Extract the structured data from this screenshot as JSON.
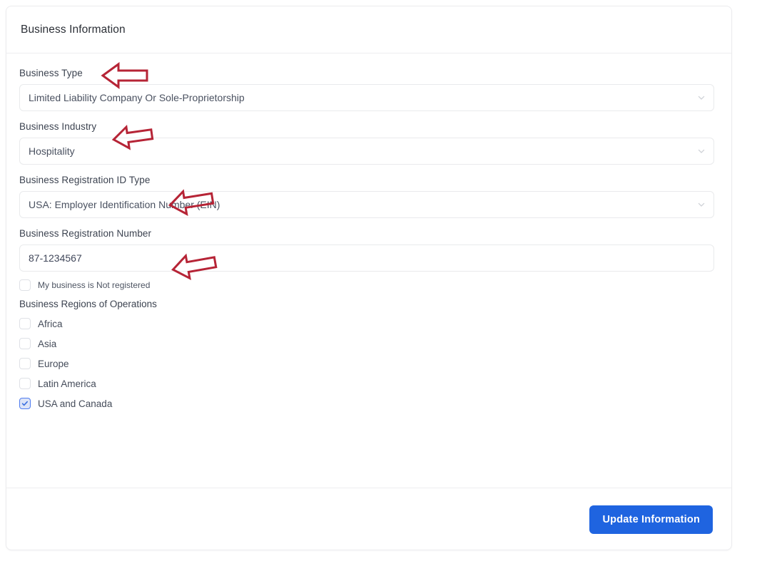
{
  "card": {
    "title": "Business Information"
  },
  "fields": {
    "business_type": {
      "label": "Business Type",
      "value": "Limited Liability Company Or Sole-Proprietorship"
    },
    "business_industry": {
      "label": "Business Industry",
      "value": "Hospitality"
    },
    "registration_id_type": {
      "label": "Business Registration ID Type",
      "value": "USA: Employer Identification Number (EIN)"
    },
    "registration_number": {
      "label": "Business Registration Number",
      "value": "87-1234567"
    }
  },
  "not_registered_checkbox": {
    "label": "My business is Not registered",
    "checked": false
  },
  "regions": {
    "label": "Business Regions of Operations",
    "items": [
      {
        "label": "Africa",
        "checked": false
      },
      {
        "label": "Asia",
        "checked": false
      },
      {
        "label": "Europe",
        "checked": false
      },
      {
        "label": "Latin America",
        "checked": false
      },
      {
        "label": "USA and Canada",
        "checked": true
      }
    ]
  },
  "footer": {
    "submit_label": "Update Information"
  },
  "icons": {
    "chevron": "chevron-down-icon",
    "check": "checkmark-icon",
    "annotation": "left-arrow-annotation"
  },
  "colors": {
    "primary_button": "#1f64e0",
    "annotation_arrow": "#b62436",
    "checkbox_checked_border": "#4f7cf0",
    "checkbox_checked_fill": "#dde4f7",
    "field_border": "#e9eaec"
  },
  "annotations": [
    {
      "name": "arrow-business-type",
      "target": "Business Type"
    },
    {
      "name": "arrow-business-industry",
      "target": "Business Industry"
    },
    {
      "name": "arrow-registration-id-type",
      "target": "Business Registration ID Type"
    },
    {
      "name": "arrow-registration-number",
      "target": "Business Registration Number"
    }
  ]
}
